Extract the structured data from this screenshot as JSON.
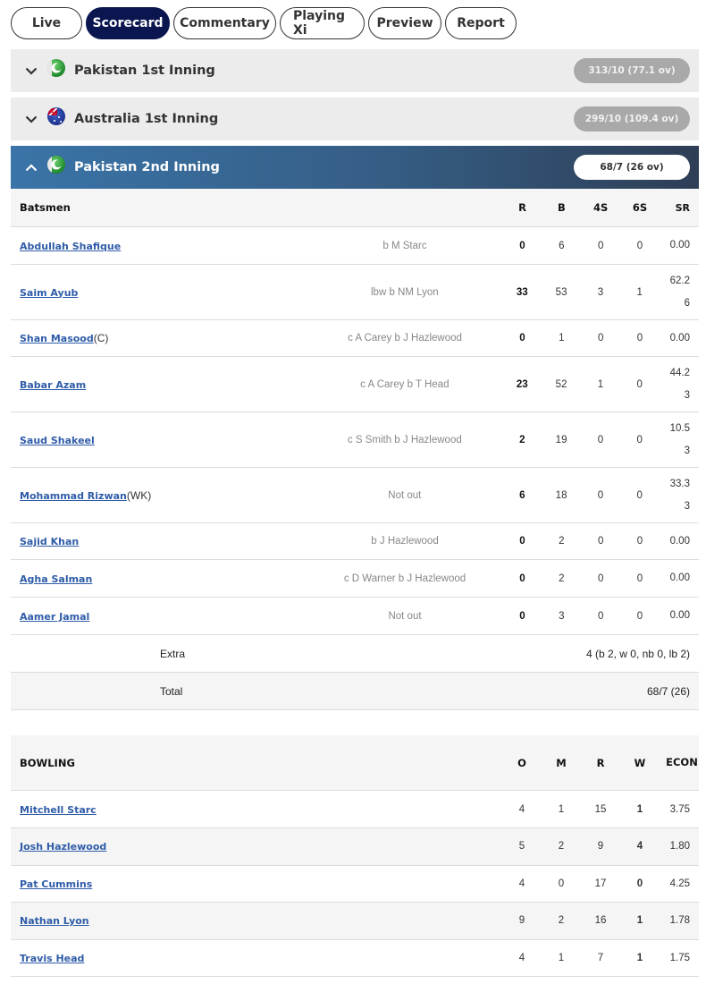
{
  "tabs": [
    {
      "label": "Live",
      "active": false
    },
    {
      "label": "Scorecard",
      "active": true
    },
    {
      "label": "Commentary",
      "active": false
    },
    {
      "label": "Playing Xi",
      "active": false
    },
    {
      "label": "Preview",
      "active": false
    },
    {
      "label": "Report",
      "active": false
    }
  ],
  "innings": [
    {
      "title": "Pakistan 1st Inning",
      "team_flag": "pakistan-flag-icon",
      "score": "313/10 (77.1 ov)",
      "expanded": false
    },
    {
      "title": "Australia 1st Inning",
      "team_flag": "australia-flag-icon",
      "score": "299/10 (109.4 ov)",
      "expanded": false
    },
    {
      "title": "Pakistan 2nd Inning",
      "team_flag": "pakistan-flag-icon",
      "score": "68/7 (26 ov)",
      "expanded": true
    }
  ],
  "batting": {
    "headers": {
      "name": "Batsmen",
      "r": "R",
      "b": "B",
      "fours": "4S",
      "sixes": "6S",
      "sr": "SR"
    },
    "rows": [
      {
        "name": "Abdullah Shafique",
        "role": "",
        "dismissal": "b M Starc",
        "r": "0",
        "b": "6",
        "fours": "0",
        "sixes": "0",
        "sr": "0.00"
      },
      {
        "name": "Saim Ayub",
        "role": "",
        "dismissal": "lbw b NM Lyon",
        "r": "33",
        "b": "53",
        "fours": "3",
        "sixes": "1",
        "sr": "62.26"
      },
      {
        "name": "Shan Masood",
        "role": "(C)",
        "dismissal": "c A Carey b J Hazlewood",
        "r": "0",
        "b": "1",
        "fours": "0",
        "sixes": "0",
        "sr": "0.00"
      },
      {
        "name": "Babar Azam",
        "role": "",
        "dismissal": "c A Carey b T Head",
        "r": "23",
        "b": "52",
        "fours": "1",
        "sixes": "0",
        "sr": "44.23"
      },
      {
        "name": "Saud Shakeel",
        "role": "",
        "dismissal": "c S Smith b J Hazlewood",
        "r": "2",
        "b": "19",
        "fours": "0",
        "sixes": "0",
        "sr": "10.53"
      },
      {
        "name": "Mohammad Rizwan",
        "role": "(WK)",
        "dismissal": "Not out",
        "r": "6",
        "b": "18",
        "fours": "0",
        "sixes": "0",
        "sr": "33.33"
      },
      {
        "name": "Sajid Khan",
        "role": "",
        "dismissal": "b J Hazlewood",
        "r": "0",
        "b": "2",
        "fours": "0",
        "sixes": "0",
        "sr": "0.00"
      },
      {
        "name": "Agha Salman",
        "role": "",
        "dismissal": "c D Warner b J Hazlewood",
        "r": "0",
        "b": "2",
        "fours": "0",
        "sixes": "0",
        "sr": "0.00"
      },
      {
        "name": "Aamer Jamal",
        "role": "",
        "dismissal": "Not out",
        "r": "0",
        "b": "3",
        "fours": "0",
        "sixes": "0",
        "sr": "0.00"
      }
    ],
    "extra": {
      "label": "Extra",
      "value": "4 (b 2, w 0, nb 0, lb 2)"
    },
    "total": {
      "label": "Total",
      "value": "68/7 (26)"
    }
  },
  "bowling": {
    "headers": {
      "name": "BOWLING",
      "o": "O",
      "m": "M",
      "r": "R",
      "w": "W",
      "econ": "ECON"
    },
    "rows": [
      {
        "name": "Mitchell Starc",
        "o": "4",
        "m": "1",
        "r": "15",
        "w": "1",
        "econ": "3.75"
      },
      {
        "name": "Josh Hazlewood",
        "o": "5",
        "m": "2",
        "r": "9",
        "w": "4",
        "econ": "1.80"
      },
      {
        "name": "Pat Cummins",
        "o": "4",
        "m": "0",
        "r": "17",
        "w": "0",
        "econ": "4.25"
      },
      {
        "name": "Nathan Lyon",
        "o": "9",
        "m": "2",
        "r": "16",
        "w": "1",
        "econ": "1.78"
      },
      {
        "name": "Travis Head",
        "o": "4",
        "m": "1",
        "r": "7",
        "w": "1",
        "econ": "1.75"
      }
    ]
  },
  "colors": {
    "active_tab": "#0b1650",
    "player_link": "#2f5ca8",
    "active_inning_start": "#3a74a8",
    "active_inning_end": "#2e3e55"
  }
}
